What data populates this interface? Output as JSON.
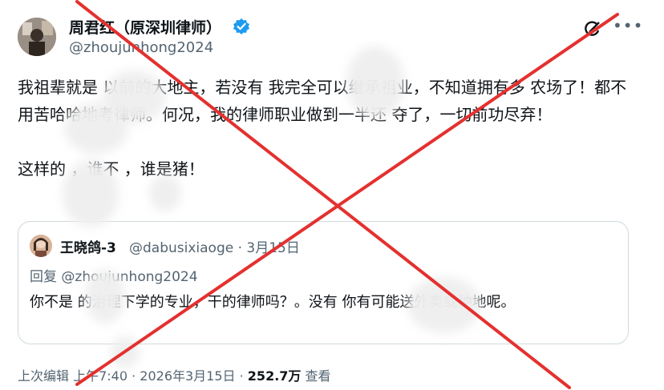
{
  "author": {
    "display_name": "周君红（原深圳律师）",
    "handle": "@zhoujunhong2024"
  },
  "tweet": {
    "paragraphs": [
      "我祖辈就是 以前的大地主，若没有 我完全可以继承祖业，不知道拥有多 农场了！都不用苦哈哈地考律师。何况，我的律师职业做到一半还 夺了，一切前功尽弃！",
      "这样的 ，谁不 ，谁是猪！"
    ]
  },
  "quote": {
    "display_name": "王晓鸽-3",
    "meta": "@dabusixiaoge · 3月15日",
    "reply_line": "回复 @zhoujunhong2024",
    "text": "你不是 的治理下学的专业，干的律师吗？。没有 你有可能送外卖或种地呢。"
  },
  "footer": {
    "edited_time": "上次编辑 上午7:40 · 2026年3月15日 · ",
    "views": "252.7万",
    "views_label": " 查看"
  },
  "colors": {
    "verified": "#1d9bf0",
    "cross": "#e3312f",
    "secondary_text": "#536471"
  },
  "icons": [
    "verified-badge-icon",
    "grok-icon",
    "more-icon"
  ]
}
